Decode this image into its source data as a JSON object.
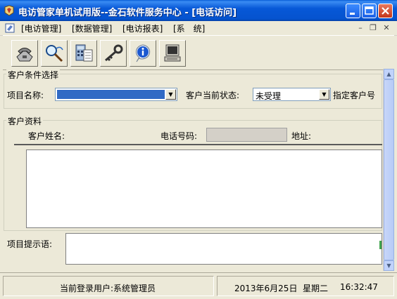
{
  "window": {
    "title": "电访管家单机试用版--金石软件服务中心 - [电话访问]",
    "colors": {
      "titlebar": "#0553cf",
      "face": "#ece9d8",
      "selection": "#316ac5"
    }
  },
  "menu": {
    "items": [
      "[电访管理]",
      "[数据管理]",
      "[电访报表]",
      "[系　统]"
    ]
  },
  "toolbar": {
    "buttons": [
      {
        "icon": "telephone-icon"
      },
      {
        "icon": "search-magnifier-icon"
      },
      {
        "icon": "calculator-sheet-icon"
      },
      {
        "icon": "key-icon"
      },
      {
        "icon": "info-icon"
      },
      {
        "icon": "computer-icon"
      }
    ]
  },
  "criteria": {
    "title": "客户条件选择",
    "project_label": "项目名称:",
    "project_value": "",
    "status_label": "客户当前状态:",
    "status_value": "未受理",
    "assigned_label": "指定客户号"
  },
  "customer": {
    "title": "客户资料",
    "name_label": "客户姓名:",
    "phone_label": "电话号码:",
    "phone_value": "",
    "address_label": "地址:"
  },
  "prompt": {
    "label": "项目提示语:",
    "value": ""
  },
  "status": {
    "user_label": "当前登录用户:系统管理员",
    "date": "2013年6月25日",
    "weekday": "星期二",
    "time": "16:32:47"
  }
}
